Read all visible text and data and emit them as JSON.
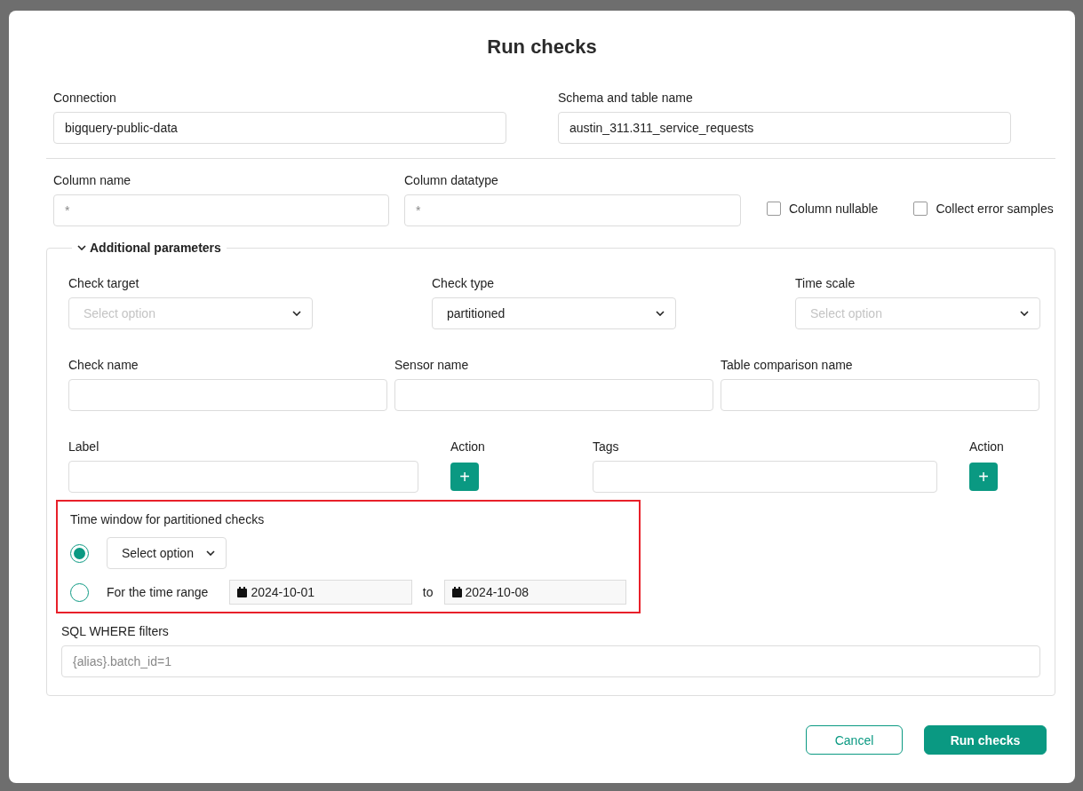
{
  "title": "Run checks",
  "table_fields": [
    {
      "label": "Connection",
      "value": "bigquery-public-data"
    },
    {
      "label": "Schema and table name",
      "value": "austin_311.311_service_requests"
    }
  ],
  "column_fields": [
    {
      "label": "Column name",
      "placeholder": "*"
    },
    {
      "label": "Column datatype",
      "placeholder": "*"
    }
  ],
  "checkboxes": [
    {
      "label": "Column nullable",
      "checked": false
    },
    {
      "label": "Collect error samples",
      "checked": false
    }
  ],
  "additional_parameters": {
    "title": "Additional parameters",
    "expanded": true,
    "selects": [
      {
        "label": "Check target",
        "placeholder": "Select option"
      },
      {
        "label": "Check type",
        "value": "partitioned"
      },
      {
        "label": "Time scale",
        "placeholder": "Select option"
      }
    ],
    "text_fields": [
      {
        "label": "Check name"
      },
      {
        "label": "Sensor name"
      },
      {
        "label": "Table comparison name"
      }
    ],
    "label_field": {
      "label": "Label",
      "action_label": "Action",
      "action_button": "+"
    },
    "tags_field": {
      "label": "Tags",
      "action_label": "Action",
      "action_button": "+"
    },
    "time_window": {
      "title": "Time window for partitioned checks",
      "highlighted": true,
      "options": [
        {
          "kind": "select",
          "selected": true,
          "placeholder": "Select option"
        },
        {
          "kind": "range",
          "selected": false,
          "label": "For the time range",
          "from": "2024-10-01",
          "separator": "to",
          "to": "2024-10-08"
        }
      ]
    },
    "sql_filters": {
      "label": "SQL WHERE filters",
      "placeholder": "{alias}.batch_id=1"
    }
  },
  "buttons": [
    {
      "label": "Cancel",
      "kind": "secondary"
    },
    {
      "label": "Run checks",
      "kind": "primary"
    }
  ]
}
